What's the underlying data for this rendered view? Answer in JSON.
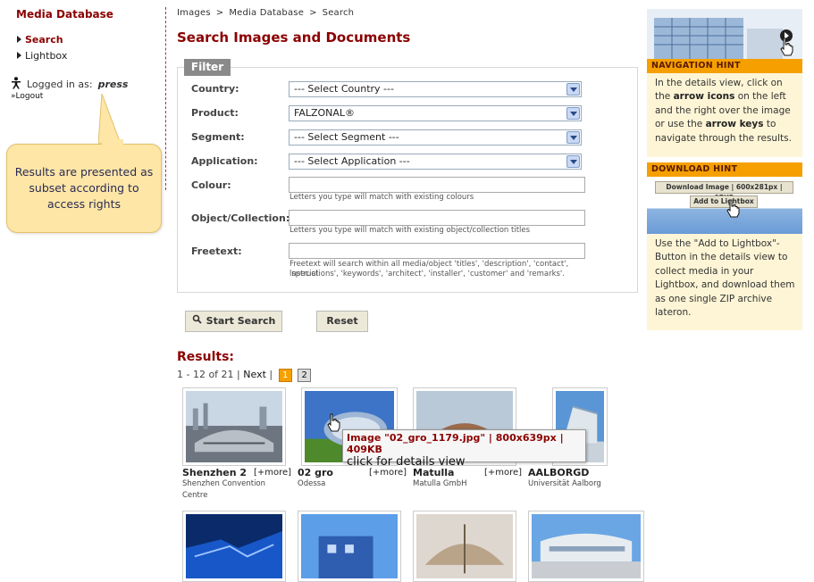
{
  "app_title": "Media Database",
  "nav": [
    {
      "label": "Search",
      "active": true
    },
    {
      "label": "Lightbox",
      "active": false
    }
  ],
  "login": {
    "prefix": "Logged in as:",
    "user": "press",
    "logout": "»Logout"
  },
  "callout": "Results are presented as subset according to access rights",
  "breadcrumb": [
    "Images",
    ">",
    "Media Database",
    ">",
    "Search"
  ],
  "page_title": "Search Images and Documents",
  "filter": {
    "tab": "Filter",
    "country": {
      "label": "Country:",
      "value": "--- Select Country ---"
    },
    "product": {
      "label": "Product:",
      "value": "FALZONAL®"
    },
    "segment": {
      "label": "Segment:",
      "value": "--- Select Segment ---"
    },
    "application": {
      "label": "Application:",
      "value": "--- Select Application ---"
    },
    "colour": {
      "label": "Colour:",
      "hint": "Letters you type will match with existing colours"
    },
    "object": {
      "label": "Object/Collection:",
      "hint": "Letters you type will match with existing object/collection titles"
    },
    "freetext": {
      "label": "Freetext:",
      "hint1": "Freetext will search within all media/object 'titles', 'description', 'contact', 'special",
      "hint2": "instructions', 'keywords', 'architect', 'installer', 'customer' and 'remarks'."
    }
  },
  "buttons": {
    "search": "Start Search",
    "reset": "Reset"
  },
  "results": {
    "title": "Results:",
    "range": "1 - 12 of 21 |",
    "next": "Next",
    "sep": "|",
    "pages": [
      "1",
      "2"
    ],
    "items": [
      {
        "title": "Shenzhen 2",
        "more": "[+more]",
        "sub": "Shenzhen Convention Centre"
      },
      {
        "title": "02 gro",
        "more": "[+more]",
        "sub": "Odessa"
      },
      {
        "title": "Matulla",
        "more": "[+more]",
        "sub": "Matulla GmbH"
      },
      {
        "title": "AALBORGD",
        "more": "",
        "sub": "Universität Aalborg"
      }
    ]
  },
  "tooltip": {
    "line1": "Image \"02_gro_1179.jpg\" | 800x639px | 409KB",
    "line2": "click for details view"
  },
  "nav_hint": {
    "title": "NAVIGATION HINT",
    "p1": "In the details view, click on the",
    "p2": "arrow icons",
    "p3": "on the left and the right over the image or use the",
    "p4": "arrow keys",
    "p5": "to navigate through the results."
  },
  "download_hint": {
    "title": "DOWNLOAD HINT",
    "btn1": "Download Image | 600x281px | 87KB",
    "btn2": "Add to Lightbox",
    "body": "Use the \"Add to Lightbox\"-Button in the details view to collect media in your Lightbox, and download them as one single ZIP archive lateron."
  },
  "colors": {
    "brand": "#8b0000",
    "accent": "#f5a000",
    "hint_bg": "#fdf5d6"
  }
}
